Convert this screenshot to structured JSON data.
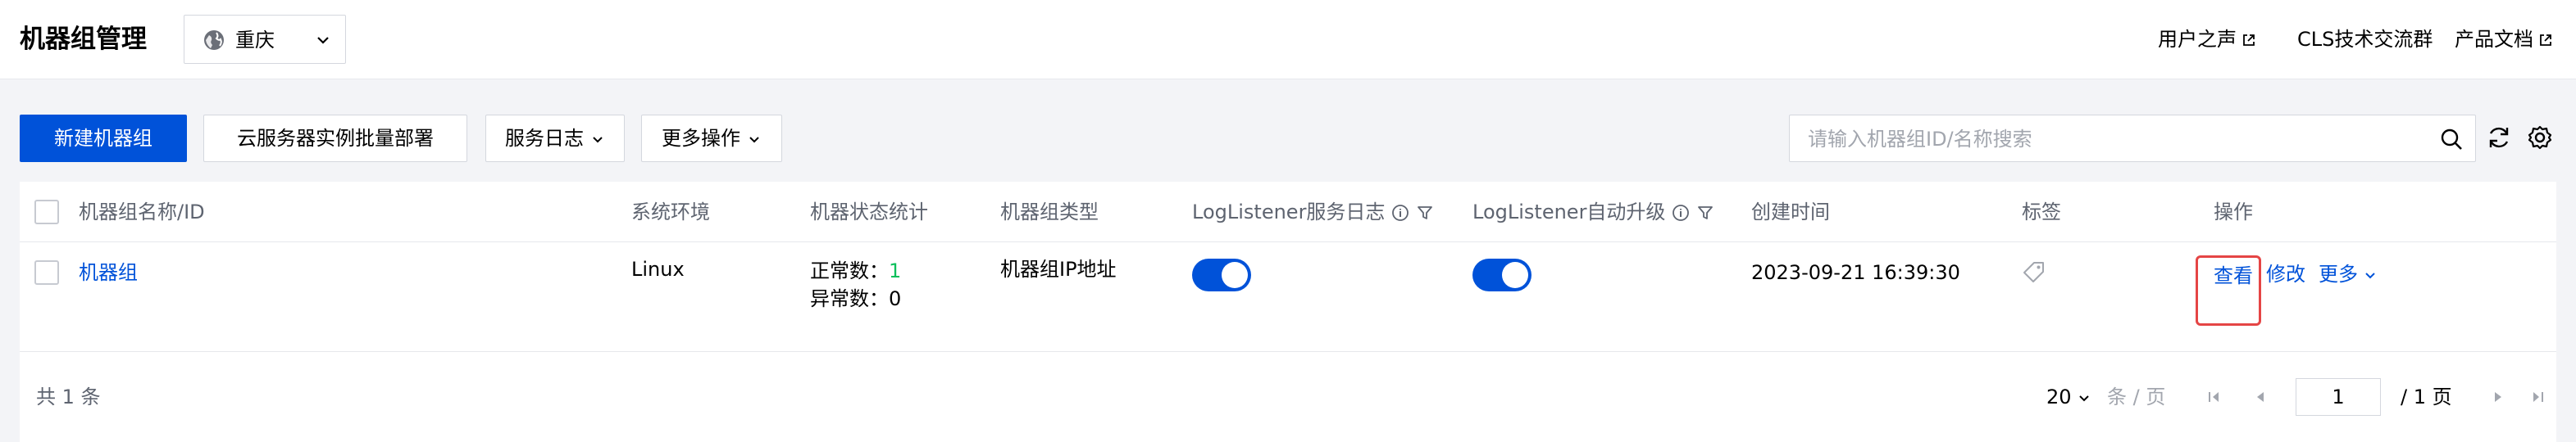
{
  "header": {
    "title": "机器组管理",
    "region": "重庆",
    "links": [
      {
        "label": "用户之声"
      },
      {
        "label": "CLS技术交流群"
      },
      {
        "label": "产品文档"
      }
    ]
  },
  "toolbar": {
    "create_label": "新建机器组",
    "batch_deploy_label": "云服务器实例批量部署",
    "service_log_label": "服务日志",
    "more_ops_label": "更多操作",
    "search_placeholder": "请输入机器组ID/名称搜索",
    "search_value": ""
  },
  "table": {
    "columns": [
      "机器组名称/ID",
      "系统环境",
      "机器状态统计",
      "机器组类型",
      "LogListener服务日志",
      "LogListener自动升级",
      "创建时间",
      "标签",
      "操作"
    ],
    "rows": [
      {
        "name": "机器组",
        "os": "Linux",
        "normal_label": "正常数：",
        "normal_count": "1",
        "abnormal_label": "异常数：",
        "abnormal_count": "0",
        "type": "机器组IP地址",
        "service_log_enabled": true,
        "auto_upgrade_enabled": true,
        "created": "2023-09-21 16:39:30",
        "actions": {
          "view": "查看",
          "edit": "修改",
          "more": "更多"
        }
      }
    ]
  },
  "footer": {
    "total": "共 1 条",
    "page_size": "20",
    "page_size_unit": "条 / 页",
    "current_page": "1",
    "total_pages": "/ 1 页"
  },
  "colors": {
    "primary": "#0052d9",
    "success": "#0abf5b",
    "highlight": "#e54545"
  }
}
